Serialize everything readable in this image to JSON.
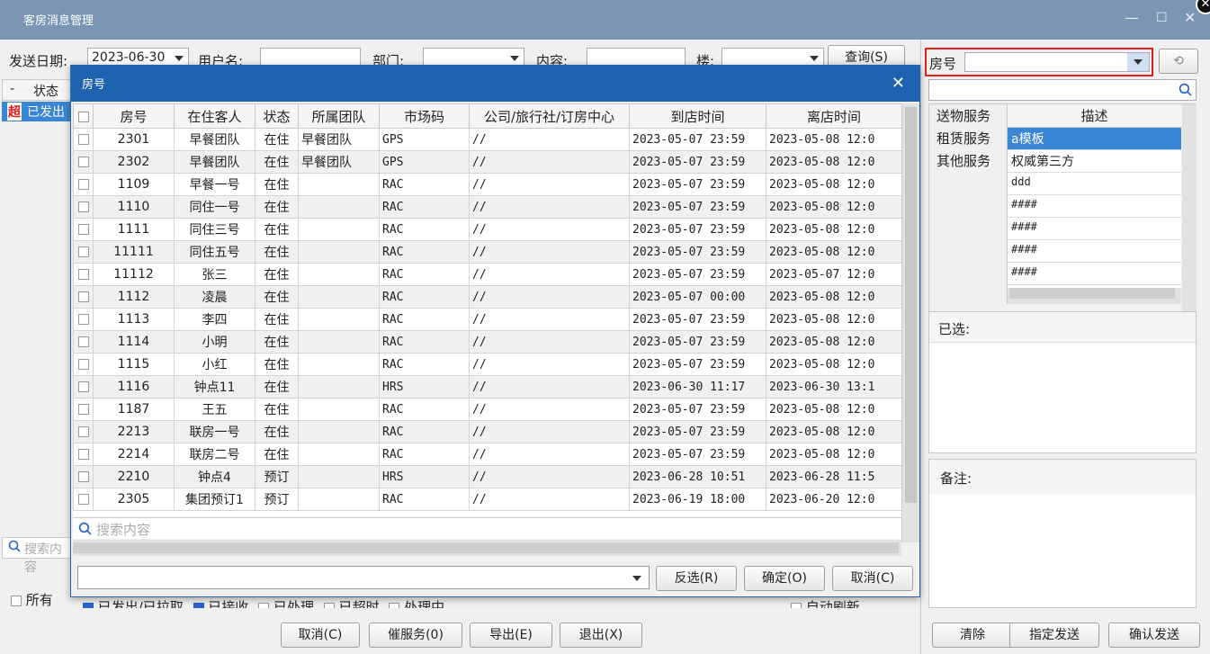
{
  "window": {
    "title": "客房消息管理",
    "min_glyph": "—",
    "max_glyph": "☐",
    "close_glyph": "✕",
    "corner_glyph": "✕"
  },
  "filter": {
    "date_label": "发送日期:",
    "date_value": "2023-06-30",
    "user_label": "用户名:",
    "user_value": "",
    "dept_label": "部门:",
    "dept_value": "",
    "content_label": "内容:",
    "content_value": "",
    "building_label": "楼:",
    "building_value": "",
    "query_button": "查询(S)"
  },
  "list": {
    "header_minus": "-",
    "header_state": "状态",
    "row_flag": "超",
    "row_state": "已发出",
    "search_placeholder": "搜索内容"
  },
  "status_filters": {
    "all": "所有",
    "sent_or_pulled": "已发出/已拉取",
    "received": "已接收",
    "processed": "已处理",
    "overdue": "已超时",
    "processing": "处理中",
    "auto_refresh": "自动刷新"
  },
  "bottom_buttons": {
    "cancel": "取消(C)",
    "urge": "催服务(0)",
    "export": "导出(E)",
    "exit": "退出(X)"
  },
  "room_dialog": {
    "title": "房号",
    "close_glyph": "✕",
    "columns": [
      "房号",
      "在住客人",
      "状态",
      "所属团队",
      "市场码",
      "公司/旅行社/订房中心",
      "到店时间",
      "离店时间"
    ],
    "rows": [
      [
        "2301",
        "早餐团队",
        "在住",
        "早餐团队",
        "GPS",
        "//",
        "2023-05-07 23:59",
        "2023-05-08 12:0"
      ],
      [
        "2302",
        "早餐团队",
        "在住",
        "早餐团队",
        "GPS",
        "//",
        "2023-05-07 23:59",
        "2023-05-08 12:0"
      ],
      [
        "1109",
        "早餐一号",
        "在住",
        "",
        "RAC",
        "//",
        "2023-05-07 23:59",
        "2023-05-08 12:0"
      ],
      [
        "1110",
        "同住一号",
        "在住",
        "",
        "RAC",
        "//",
        "2023-05-07 23:59",
        "2023-05-08 12:0"
      ],
      [
        "1111",
        "同住三号",
        "在住",
        "",
        "RAC",
        "//",
        "2023-05-07 23:59",
        "2023-05-08 12:0"
      ],
      [
        "11111",
        "同住五号",
        "在住",
        "",
        "RAC",
        "//",
        "2023-05-07 23:59",
        "2023-05-08 12:0"
      ],
      [
        "11112",
        "张三",
        "在住",
        "",
        "RAC",
        "//",
        "2023-05-07 23:59",
        "2023-05-07 12:0"
      ],
      [
        "1112",
        "凌晨",
        "在住",
        "",
        "RAC",
        "//",
        "2023-05-07 00:00",
        "2023-05-08 12:0"
      ],
      [
        "1113",
        "李四",
        "在住",
        "",
        "RAC",
        "//",
        "2023-05-07 23:59",
        "2023-05-08 12:0"
      ],
      [
        "1114",
        "小明",
        "在住",
        "",
        "RAC",
        "//",
        "2023-05-07 23:59",
        "2023-05-08 12:0"
      ],
      [
        "1115",
        "小红",
        "在住",
        "",
        "RAC",
        "//",
        "2023-05-07 23:59",
        "2023-05-08 12:0"
      ],
      [
        "1116",
        "钟点11",
        "在住",
        "",
        "HRS",
        "//",
        "2023-06-30 11:17",
        "2023-06-30 13:1"
      ],
      [
        "1187",
        "王五",
        "在住",
        "",
        "RAC",
        "//",
        "2023-05-07 23:59",
        "2023-05-08 12:0"
      ],
      [
        "2213",
        "联房一号",
        "在住",
        "",
        "RAC",
        "//",
        "2023-05-07 23:59",
        "2023-05-08 12:0"
      ],
      [
        "2214",
        "联房二号",
        "在住",
        "",
        "RAC",
        "//",
        "2023-05-07 23:59",
        "2023-05-08 12:0"
      ],
      [
        "2210",
        "钟点4",
        "预订",
        "",
        "HRS",
        "//",
        "2023-06-28 10:51",
        "2023-06-28 11:5"
      ],
      [
        "2305",
        "集团预订1",
        "预订",
        "",
        "RAC",
        "//",
        "2023-06-19 18:00",
        "2023-06-20 12:0"
      ]
    ],
    "search_placeholder": "搜索内容",
    "footer_select_value": "",
    "invert_button": "反选(R)",
    "ok_button": "确定(O)",
    "cancel_button": "取消(C)"
  },
  "right_panel": {
    "room_label": "房号",
    "room_value": "",
    "search_value": "",
    "categories": [
      "送物服务",
      "租赁服务",
      "其他服务"
    ],
    "desc_header": "描述",
    "descriptions": [
      "a模板",
      "权威第三方",
      "ddd",
      "####",
      "####",
      "####",
      "####"
    ],
    "selected_label": "已选:",
    "remark_label": "备注:",
    "clear_button": "清除",
    "assign_button": "指定发送",
    "confirm_button": "确认发送"
  },
  "colors": {
    "titlebar": "#7b96b5",
    "dialog_header": "#1f63b0",
    "highlight": "#3a86d6",
    "red_border": "#e02020"
  }
}
